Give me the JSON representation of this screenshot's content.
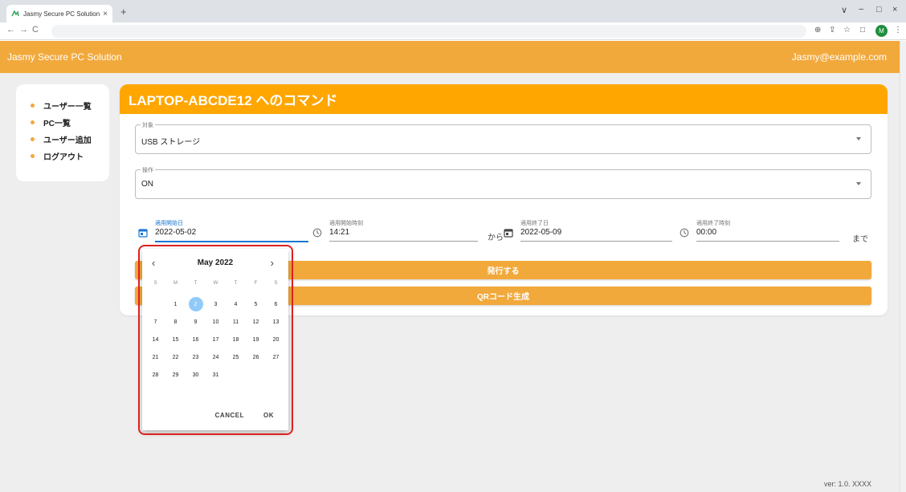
{
  "browser": {
    "tab_title": "Jasmy Secure PC Solution",
    "tab_close": "×",
    "new_tab": "+",
    "back": "←",
    "forward": "→",
    "reload": "C",
    "profile_initial": "M",
    "window_controls": [
      "∨",
      "−",
      "□",
      "×"
    ],
    "toolbar_icons": [
      "⊕",
      "⇪",
      "☆",
      "□",
      "⋮"
    ]
  },
  "header": {
    "app_title": "Jasmy Secure PC Solution",
    "user_email": "Jasmy@example.com"
  },
  "sidebar": {
    "items": [
      {
        "label": "ユーザー一覧"
      },
      {
        "label": "PC一覧"
      },
      {
        "label": "ユーザー追加"
      },
      {
        "label": "ログアウト"
      }
    ]
  },
  "card": {
    "title": "LAPTOP-ABCDE12 へのコマンド",
    "target_field": {
      "label": "対象",
      "value": "USB ストレージ"
    },
    "operation_field": {
      "label": "操作",
      "value": "ON"
    },
    "start_date": {
      "label": "適用開始日",
      "value": "2022-05-02"
    },
    "start_time": {
      "label": "適用開始時刻",
      "value": "14:21"
    },
    "from_text": "から",
    "end_date": {
      "label": "適用終了日",
      "value": "2022-05-09"
    },
    "end_time": {
      "label": "適用終了時刻",
      "value": "00:00"
    },
    "until_text": "まで",
    "issue_button": "発行する",
    "qr_button": "QRコード生成"
  },
  "date_picker": {
    "month_label": "May 2022",
    "prev": "‹",
    "next": "›",
    "weekdays": [
      "S",
      "M",
      "T",
      "W",
      "T",
      "F",
      "S"
    ],
    "days": [
      "",
      "1",
      "2",
      "3",
      "4",
      "5",
      "6",
      "7",
      "8",
      "9",
      "10",
      "11",
      "12",
      "13",
      "14",
      "15",
      "16",
      "17",
      "18",
      "19",
      "20",
      "21",
      "22",
      "23",
      "24",
      "25",
      "26",
      "27",
      "28",
      "29",
      "30",
      "31"
    ],
    "selected_day": "2",
    "cancel_label": "CANCEL",
    "ok_label": "OK"
  },
  "footer": {
    "version": "ver: 1.0. XXXX"
  },
  "colors": {
    "accent": "#f2a93b",
    "card_header": "#ffa600",
    "selected_day": "#90caf9",
    "highlight": "#e02020"
  }
}
